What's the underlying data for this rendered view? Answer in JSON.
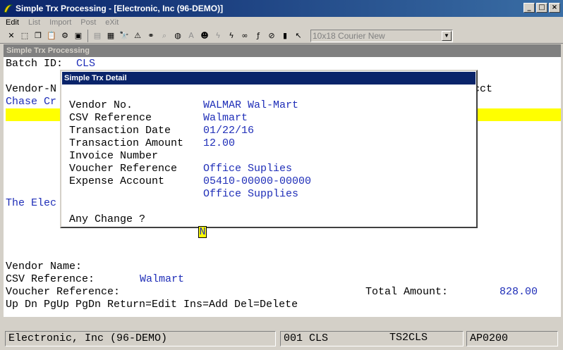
{
  "window": {
    "title": "Simple Trx Processing - [Electronic, Inc (96-DEMO)]",
    "minimize": "_",
    "maximize": "□",
    "close": "×"
  },
  "menu": {
    "edit": "Edit",
    "list": "List",
    "import": "Import",
    "post": "Post",
    "exit": "eXit"
  },
  "toolbar": {
    "font_select": "10x18 Courier New"
  },
  "inner_window": {
    "title": "Simple Trx Processing"
  },
  "screen": {
    "batch_label": "Batch ID:",
    "batch_value": "CLS",
    "vendor_header_partial": "Vendor-N",
    "acct_partial": "cct",
    "chase_partial": "Chase Cr",
    "electronic_partial": "The Elec",
    "vendor_name_label": "Vendor Name:",
    "csv_ref_label": "CSV Reference:",
    "csv_ref_value": "Walmart",
    "voucher_ref_label": "Voucher Reference:",
    "total_label": "Total Amount:",
    "total_value": "828.00",
    "help_line": "Up Dn PgUp PgDn Return=Edit Ins=Add Del=Delete"
  },
  "dialog": {
    "title": "Simple Trx Detail",
    "fields": [
      {
        "label": "Vendor No.",
        "value": "WALMAR Wal-Mart"
      },
      {
        "label": "CSV Reference",
        "value": "Walmart"
      },
      {
        "label": "Transaction Date",
        "value": "01/22/16"
      },
      {
        "label": "Transaction Amount",
        "value": "12.00"
      },
      {
        "label": "Invoice Number",
        "value": ""
      },
      {
        "label": "Voucher Reference",
        "value": "Office Suplies"
      },
      {
        "label": "Expense Account",
        "value": "05410-00000-00000"
      },
      {
        "label": "",
        "value": "Office Supplies"
      }
    ],
    "prompt": "Any Change ?",
    "answer": "N"
  },
  "status": {
    "company": "Electronic, Inc (96-DEMO)",
    "batch": "001 CLS",
    "program": "TS2CLS",
    "code": "AP0200"
  }
}
